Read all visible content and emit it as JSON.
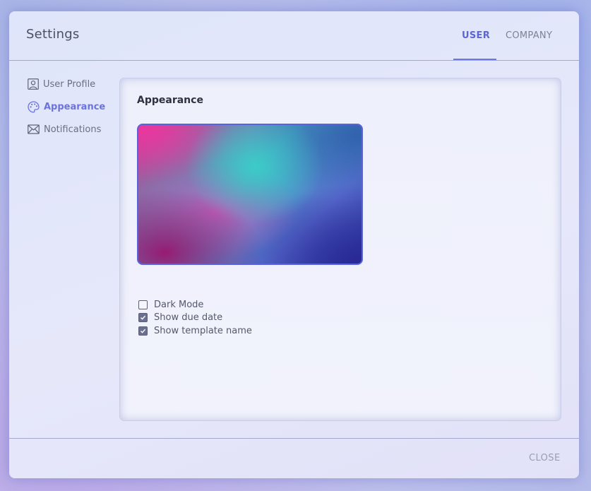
{
  "header": {
    "title": "Settings",
    "tabs": [
      {
        "label": "USER",
        "active": true
      },
      {
        "label": "COMPANY",
        "active": false
      }
    ]
  },
  "sidebar": {
    "items": [
      {
        "label": "User Profile",
        "icon": "user-profile-icon",
        "active": false
      },
      {
        "label": "Appearance",
        "icon": "palette-icon",
        "active": true
      },
      {
        "label": "Notifications",
        "icon": "envelope-icon",
        "active": false
      }
    ]
  },
  "panel": {
    "title": "Appearance",
    "options": [
      {
        "label": "Dark Mode",
        "checked": false
      },
      {
        "label": "Show due date",
        "checked": true
      },
      {
        "label": "Show template name",
        "checked": true
      }
    ]
  },
  "footer": {
    "close_label": "CLOSE"
  },
  "colors": {
    "accent": "#5b67d3",
    "preview_border": "#5864dc"
  }
}
